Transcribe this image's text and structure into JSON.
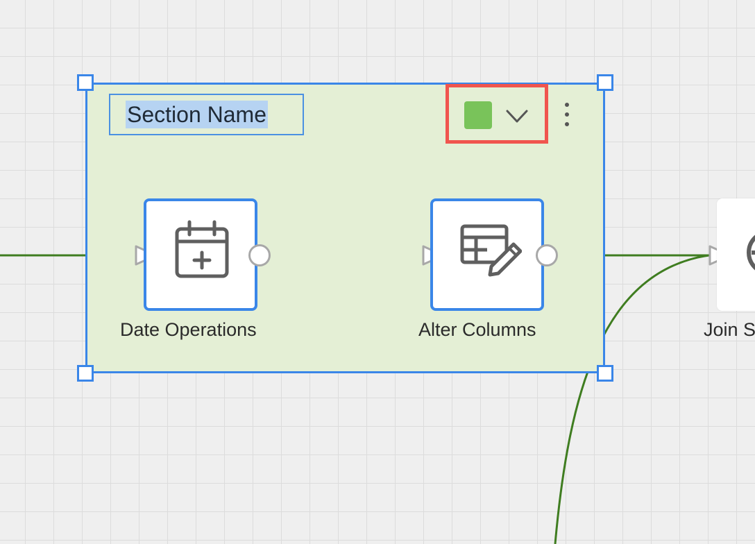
{
  "section": {
    "name": "Section Name",
    "color": "#79c35a",
    "fill_color": "#e4efd5",
    "selection_color": "#3a86e8"
  },
  "color_picker": {
    "swatch_icon": "color-swatch-icon",
    "dropdown_icon": "chevron-down-icon",
    "highlight_color": "#f0554e"
  },
  "more_menu": {
    "icon": "more-vertical-icon"
  },
  "nodes": [
    {
      "label": "Date Operations",
      "icon": "calendar-plus-icon"
    },
    {
      "label": "Alter Columns",
      "icon": "table-edit-icon"
    },
    {
      "label": "Join S",
      "icon": "join-icon"
    }
  ],
  "connection_color": "#3f7d20"
}
